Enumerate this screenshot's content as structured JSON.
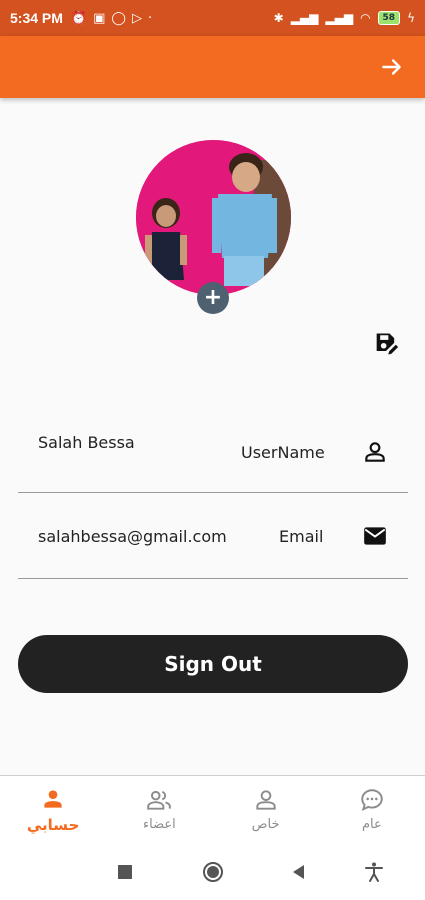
{
  "status_bar": {
    "time": "5:34 PM",
    "battery": "58"
  },
  "app_bar": {
    "action_icon": "arrow-right-icon"
  },
  "profile": {
    "add_label": "+",
    "fields": [
      {
        "value": "Salah Bessa",
        "label": "UserName",
        "icon": "person-icon"
      },
      {
        "value": "salahbessa@gmail.com",
        "label": "Email",
        "icon": "mail-icon"
      }
    ],
    "sign_out_label": "Sign Out"
  },
  "bottom_nav": {
    "items": [
      {
        "label": "حسابي",
        "icon": "person-icon",
        "active": true
      },
      {
        "label": "اعضاء",
        "icon": "group-icon",
        "active": false
      },
      {
        "label": "خاص",
        "icon": "person-outline-icon",
        "active": false
      },
      {
        "label": "عام",
        "icon": "chat-icon",
        "active": false
      }
    ]
  },
  "colors": {
    "accent": "#f36b21",
    "status_bar": "#d3521f",
    "button": "#222222"
  }
}
